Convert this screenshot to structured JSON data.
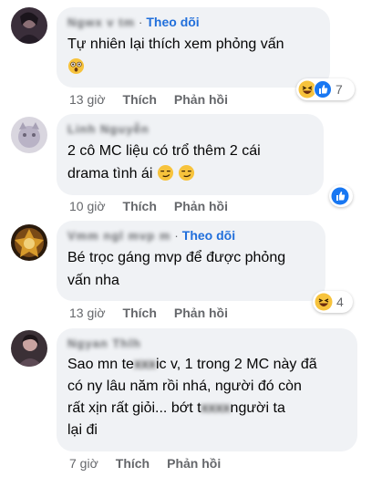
{
  "comments": [
    {
      "author": "Ngwx v tm",
      "follow": "Theo dõi",
      "text_lines": [
        "Tự nhiên lại thích xem phỏng vấn"
      ],
      "time": "13 giờ",
      "like": "Thích",
      "reply": "Phản hồi",
      "reaction_count": "7",
      "reactions": [
        "haha-icon",
        "like-icon"
      ]
    },
    {
      "author": "Linh Nguyễn",
      "text_lines": [
        "2 cô MC liệu có trổ thêm 2 cái",
        "drama tình ái"
      ],
      "time": "10 giờ",
      "like": "Thích",
      "reply": "Phản hồi",
      "reactions": [
        "like-icon"
      ]
    },
    {
      "author": "Vmm ngl mvp m",
      "follow": "Theo dõi",
      "text_lines": [
        "Bé trọc gáng mvp để được phỏng",
        "vấn nha"
      ],
      "time": "13 giờ",
      "like": "Thích",
      "reply": "Phản hồi",
      "reaction_count": "4",
      "reactions": [
        "haha-icon"
      ]
    },
    {
      "author": "Ngyan Thlh",
      "text_lines": [
        "Sao mn te",
        "ic v, 1 trong 2 MC này đã",
        "có ny lâu năm rồi nhá, người đó còn",
        "rất xịn rất giỏi... bớt t",
        "người ta",
        "lại đi"
      ],
      "time": "7 giờ",
      "like": "Thích",
      "reply": "Phản hồi"
    }
  ],
  "colors": {
    "bubble": "#f0f2f5",
    "follow": "#216fdb",
    "meta": "#65676b",
    "like_blue": "#1877f2",
    "haha_yellow": "#f7c33c"
  }
}
